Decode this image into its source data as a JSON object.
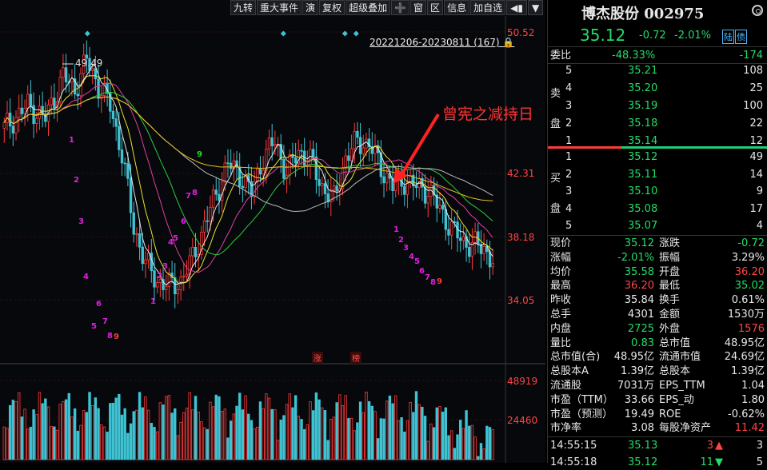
{
  "toolbar": [
    "九转",
    "重大事件",
    "演",
    "复权",
    "超级叠加",
    "➕",
    "窗",
    "区",
    "信息",
    "加自选"
  ],
  "toolbar_icons": [
    "sound-icon",
    "dropdown-icon"
  ],
  "price_axis": [
    "50.52",
    "42.31",
    "38.18",
    "34.05"
  ],
  "range_label": "20221206-20230811 (167)",
  "max_label": "49.49",
  "annotation": "曾宪之减持日",
  "volume_axis": [
    "48919",
    "24460"
  ],
  "markers": [
    "涨",
    "榜"
  ],
  "sequence_numbers": {
    "down1": [
      "1",
      "2",
      "3",
      "4",
      "5",
      "6",
      "7",
      "8",
      "9"
    ],
    "up": [
      "1",
      "2",
      "3",
      "4",
      "5",
      "6",
      "7",
      "8",
      "9"
    ],
    "down2": [
      "1",
      "2",
      "3",
      "4",
      "5",
      "6",
      "7",
      "8",
      "9"
    ]
  },
  "stock": {
    "name": "博杰股份",
    "code": "002975",
    "price": "35.12",
    "change": "-0.72",
    "change_pct": "-2.01%",
    "tags": [
      "陆",
      "债"
    ]
  },
  "order_book": {
    "ratio_label": "委比",
    "ratio": "-48.33%",
    "diff": "-174",
    "sell_label": [
      "卖",
      "盘"
    ],
    "buy_label": [
      "买",
      "盘"
    ],
    "sell": [
      {
        "level": "5",
        "price": "35.21",
        "vol": "108"
      },
      {
        "level": "4",
        "price": "35.20",
        "vol": "25"
      },
      {
        "level": "3",
        "price": "35.19",
        "vol": "100"
      },
      {
        "level": "2",
        "price": "35.18",
        "vol": "22"
      },
      {
        "level": "1",
        "price": "35.14",
        "vol": "12"
      }
    ],
    "buy": [
      {
        "level": "1",
        "price": "35.12",
        "vol": "49"
      },
      {
        "level": "2",
        "price": "35.11",
        "vol": "14"
      },
      {
        "level": "3",
        "price": "35.10",
        "vol": "9"
      },
      {
        "level": "4",
        "price": "35.08",
        "vol": "17"
      },
      {
        "level": "5",
        "price": "35.07",
        "vol": "4"
      }
    ]
  },
  "stats": [
    [
      {
        "label": "现价",
        "value": "35.12",
        "color": "green"
      },
      {
        "label": "涨跌",
        "value": "-0.72",
        "color": "green"
      }
    ],
    [
      {
        "label": "涨幅",
        "value": "-2.01%",
        "color": "green"
      },
      {
        "label": "振幅",
        "value": "3.29%",
        "color": "white"
      }
    ],
    [
      {
        "label": "均价",
        "value": "35.58",
        "color": "green"
      },
      {
        "label": "开盘",
        "value": "36.20",
        "color": "red"
      }
    ],
    [
      {
        "label": "最高",
        "value": "36.20",
        "color": "red"
      },
      {
        "label": "最低",
        "value": "35.02",
        "color": "green"
      }
    ],
    [
      {
        "label": "昨收",
        "value": "35.84",
        "color": "white"
      },
      {
        "label": "换手",
        "value": "0.61%",
        "color": "white"
      }
    ],
    [
      {
        "label": "总手",
        "value": "4301",
        "color": "white"
      },
      {
        "label": "金额",
        "value": "1530万",
        "color": "white"
      }
    ],
    [
      {
        "label": "内盘",
        "value": "2725",
        "color": "green"
      },
      {
        "label": "外盘",
        "value": "1576",
        "color": "red"
      }
    ],
    [
      {
        "label": "量比",
        "value": "0.83",
        "color": "green"
      },
      {
        "label": "总市值",
        "value": "48.95亿",
        "color": "white"
      }
    ],
    [
      {
        "label": "总市值(合)",
        "value": "48.95亿",
        "color": "white"
      },
      {
        "label": "流通市值",
        "value": "24.69亿",
        "color": "white"
      }
    ],
    [
      {
        "label": "总股本A",
        "value": "1.39亿",
        "color": "white"
      },
      {
        "label": "总股本",
        "value": "1.39亿",
        "color": "white"
      }
    ],
    [
      {
        "label": "流通股",
        "value": "7031万",
        "color": "white"
      },
      {
        "label": "EPS_TTM",
        "value": "1.04",
        "color": "white"
      }
    ],
    [
      {
        "label": "市盈（TTM）",
        "value": "33.66",
        "color": "white"
      },
      {
        "label": "EPS_动",
        "value": "1.80",
        "color": "white"
      }
    ],
    [
      {
        "label": "市盈（预测）",
        "value": "19.49",
        "color": "white"
      },
      {
        "label": "ROE",
        "value": "-0.62%",
        "color": "white"
      }
    ],
    [
      {
        "label": "市净率",
        "value": "3.08",
        "color": "white"
      },
      {
        "label": "每股净资产",
        "value": "11.42",
        "color": "red"
      }
    ]
  ],
  "ticks": [
    {
      "time": "14:55:15",
      "price": "35.13",
      "vol": "3",
      "dir": "up",
      "count": "3"
    },
    {
      "time": "14:55:18",
      "price": "35.12",
      "vol": "11",
      "dir": "down",
      "count": "5"
    }
  ],
  "colors": {
    "up": "#ff3b3b",
    "down": "#3fc3d3",
    "green": "#22dd66",
    "accent": "#4ab8ff"
  },
  "chart_data": {
    "type": "candlestick",
    "price_range": [
      34.05,
      50.52
    ],
    "volume_range": [
      0,
      48919
    ],
    "series_shown": [
      "price",
      "ma5",
      "ma10",
      "ma20",
      "ma30",
      "ma60",
      "ma120",
      "volume"
    ]
  }
}
